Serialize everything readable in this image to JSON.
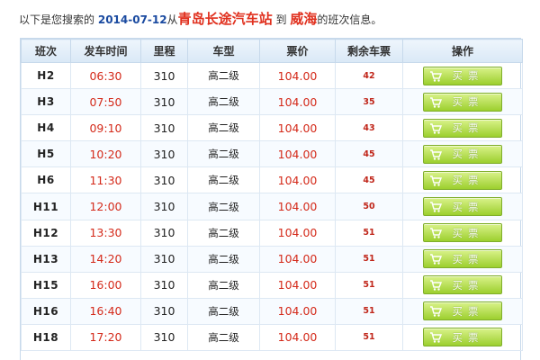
{
  "summary": {
    "prefix": "以下是您搜索的",
    "date": "2014-07-12",
    "from_word": "从",
    "origin": "青岛长途汽车站",
    "to_word": "到",
    "destination": "威海",
    "suffix": "的班次信息。"
  },
  "table": {
    "columns": [
      "班次",
      "发车时间",
      "里程",
      "车型",
      "票价",
      "剩余车票",
      "操作"
    ],
    "button_label": "买票",
    "rows": [
      {
        "code": "H2",
        "time": "06:30",
        "distance": "310",
        "type": "高二级",
        "price": "104.00",
        "left": "42"
      },
      {
        "code": "H3",
        "time": "07:50",
        "distance": "310",
        "type": "高二级",
        "price": "104.00",
        "left": "35"
      },
      {
        "code": "H4",
        "time": "09:10",
        "distance": "310",
        "type": "高二级",
        "price": "104.00",
        "left": "43"
      },
      {
        "code": "H5",
        "time": "10:20",
        "distance": "310",
        "type": "高二级",
        "price": "104.00",
        "left": "45"
      },
      {
        "code": "H6",
        "time": "11:30",
        "distance": "310",
        "type": "高二级",
        "price": "104.00",
        "left": "45"
      },
      {
        "code": "H11",
        "time": "12:00",
        "distance": "310",
        "type": "高二级",
        "price": "104.00",
        "left": "50"
      },
      {
        "code": "H12",
        "time": "13:30",
        "distance": "310",
        "type": "高二级",
        "price": "104.00",
        "left": "51"
      },
      {
        "code": "H13",
        "time": "14:20",
        "distance": "310",
        "type": "高二级",
        "price": "104.00",
        "left": "51"
      },
      {
        "code": "H15",
        "time": "16:00",
        "distance": "310",
        "type": "高二级",
        "price": "104.00",
        "left": "51"
      },
      {
        "code": "H16",
        "time": "16:40",
        "distance": "310",
        "type": "高二级",
        "price": "104.00",
        "left": "51"
      },
      {
        "code": "H18",
        "time": "17:20",
        "distance": "310",
        "type": "高二级",
        "price": "104.00",
        "left": "51"
      }
    ]
  },
  "colors": {
    "date": "#1a4aa0",
    "station": "#e0301e",
    "price": "#d42a1a",
    "button": "#9ccf2e"
  },
  "icons": {
    "buy_button_icon": "shopping-cart-icon"
  }
}
